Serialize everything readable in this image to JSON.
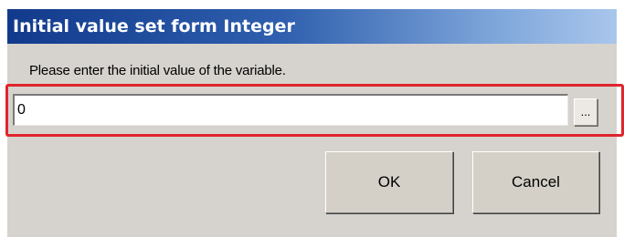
{
  "dialog": {
    "title": "Initial value set form Integer",
    "prompt": "Please enter the initial value of the variable.",
    "value": "0",
    "browse_label": "...",
    "ok_label": "OK",
    "cancel_label": "Cancel"
  },
  "colors": {
    "dialog_background": "#d6d3ce",
    "titlebar_start": "#123a8c",
    "titlebar_end": "#a9c6ec",
    "highlight_border": "#e0242c"
  }
}
